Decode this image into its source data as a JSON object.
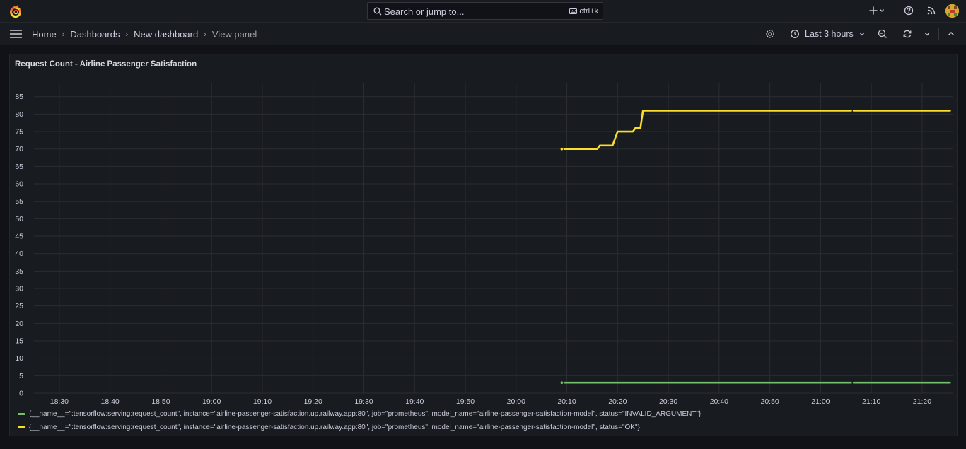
{
  "topbar": {
    "search_placeholder": "Search or jump to...",
    "shortcut": "ctrl+k",
    "icons": [
      "grafana-logo-icon",
      "search-icon",
      "plus-icon",
      "help-icon",
      "news-icon",
      "avatar"
    ]
  },
  "breadcrumbs": [
    {
      "label": "Home"
    },
    {
      "label": "Dashboards"
    },
    {
      "label": "New dashboard"
    },
    {
      "label": "View panel"
    }
  ],
  "toolbar": {
    "time_range": "Last 3 hours"
  },
  "panel": {
    "title": "Request Count - Airline Passenger Satisfaction"
  },
  "colors": {
    "background": "#111217",
    "panel": "#181b1f",
    "grid": "#2b2d33",
    "series_green": "#73bf69",
    "series_yellow": "#fade2a"
  },
  "chart_data": {
    "type": "line",
    "x_ticks": [
      "18:30",
      "18:40",
      "18:50",
      "19:00",
      "19:10",
      "19:20",
      "19:30",
      "19:40",
      "19:50",
      "20:00",
      "20:10",
      "20:20",
      "20:30",
      "20:40",
      "20:50",
      "21:00",
      "21:10",
      "21:20"
    ],
    "y_ticks": [
      0,
      5,
      10,
      15,
      20,
      25,
      30,
      35,
      40,
      45,
      50,
      55,
      60,
      65,
      70,
      75,
      80,
      85
    ],
    "ylim": [
      0,
      89
    ],
    "xlim": [
      "18:25",
      "21:26"
    ],
    "grid": true,
    "legend_placement": "bottom",
    "series": [
      {
        "name": "{__name__=\":tensorflow:serving:request_count\", instance=\"airline-passenger-satisfaction.up.railway.app:80\", job=\"prometheus\", model_name=\"airline-passenger-satisfaction-model\", status=\"INVALID_ARGUMENT\"}",
        "color": "#73bf69",
        "segments": [
          [
            [
              "20:09",
              3
            ]
          ],
          [
            [
              "20:09.5",
              3
            ],
            [
              "21:06",
              3
            ]
          ],
          [
            [
              "21:06.5",
              3
            ],
            [
              "21:25.5",
              3
            ]
          ]
        ]
      },
      {
        "name": "{__name__=\":tensorflow:serving:request_count\", instance=\"airline-passenger-satisfaction.up.railway.app:80\", job=\"prometheus\", model_name=\"airline-passenger-satisfaction-model\", status=\"OK\"}",
        "color": "#fade2a",
        "segments": [
          [
            [
              "20:09",
              70
            ]
          ],
          [
            [
              "20:09.5",
              70
            ],
            [
              "20:16",
              70
            ],
            [
              "20:16.5",
              71
            ],
            [
              "20:19",
              71
            ],
            [
              "20:20",
              75
            ],
            [
              "20:23",
              75
            ],
            [
              "20:23.5",
              76
            ],
            [
              "20:24.5",
              76
            ],
            [
              "20:25",
              81
            ],
            [
              "21:06",
              81
            ]
          ],
          [
            [
              "21:06.5",
              81
            ],
            [
              "21:25.5",
              81
            ]
          ]
        ]
      }
    ]
  }
}
